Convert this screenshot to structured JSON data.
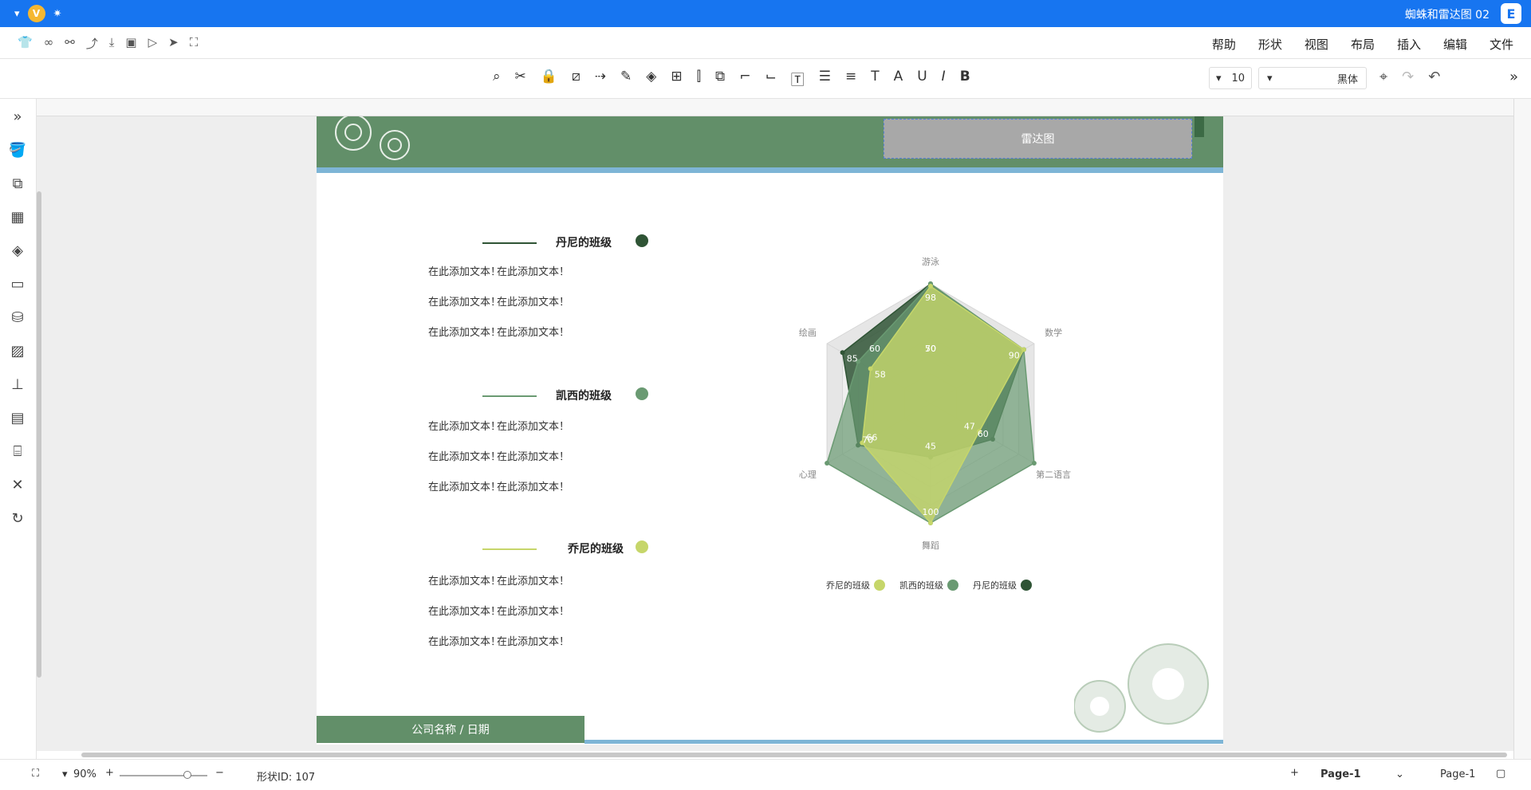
{
  "titlebar": {
    "title": "蜘蛛和雷达图 02",
    "badge": "V",
    "logo": "E"
  },
  "menubar": {
    "menus": [
      "文件",
      "编辑",
      "插入",
      "布局",
      "视图",
      "形状",
      "帮助"
    ]
  },
  "toolbar": {
    "font": "黑体",
    "size": "10"
  },
  "page": {
    "title_box": "雷达图",
    "footer": "公司名称 / 日期",
    "legend_groups": [
      {
        "title": "丹尼的班级",
        "color": "#2f5435",
        "lines": [
          "在此添加文本！",
          "在此添加文本！",
          "在此添加文本！"
        ]
      },
      {
        "title": "凯西的班级",
        "color": "#6a9a72",
        "lines": [
          "在此添加文本！",
          "在此添加文本！",
          "在此添加文本！"
        ]
      },
      {
        "title": "乔尼的班级",
        "color": "#c6d66a",
        "lines": [
          "在此添加文本！",
          "在此添加文本！",
          "在此添加文本！"
        ]
      }
    ],
    "text_second_col": "在此添加文本！"
  },
  "chart_data": {
    "type": "radar",
    "axes": [
      "游泳",
      "绘画",
      "心理",
      "舞蹈",
      "第二语言",
      "数学"
    ],
    "rmax": 100,
    "grid_labels": [
      "50",
      "60",
      "70"
    ],
    "series": [
      {
        "name": "丹尼的班级",
        "color": "#2f5435",
        "values": [
          100,
          85,
          70,
          45,
          60,
          90
        ]
      },
      {
        "name": "凯西的班级",
        "color": "#6a9a72",
        "values": [
          100,
          70,
          100,
          100,
          100,
          90
        ]
      },
      {
        "name": "乔尼的班级",
        "color": "#c6d66a",
        "values": [
          98,
          58,
          66,
          100,
          47,
          90
        ]
      }
    ],
    "point_labels": [
      "100",
      "98",
      "85",
      "70",
      "58",
      "66",
      "100",
      "100",
      "45",
      "47",
      "60",
      "90"
    ],
    "legend": [
      "丹尼的班级",
      "凯西的班级",
      "乔尼的班级"
    ]
  },
  "statusbar": {
    "page_tab": "Page-1",
    "page_select": "Page-1",
    "shape_id": "形状ID: 107",
    "zoom": "90%"
  }
}
